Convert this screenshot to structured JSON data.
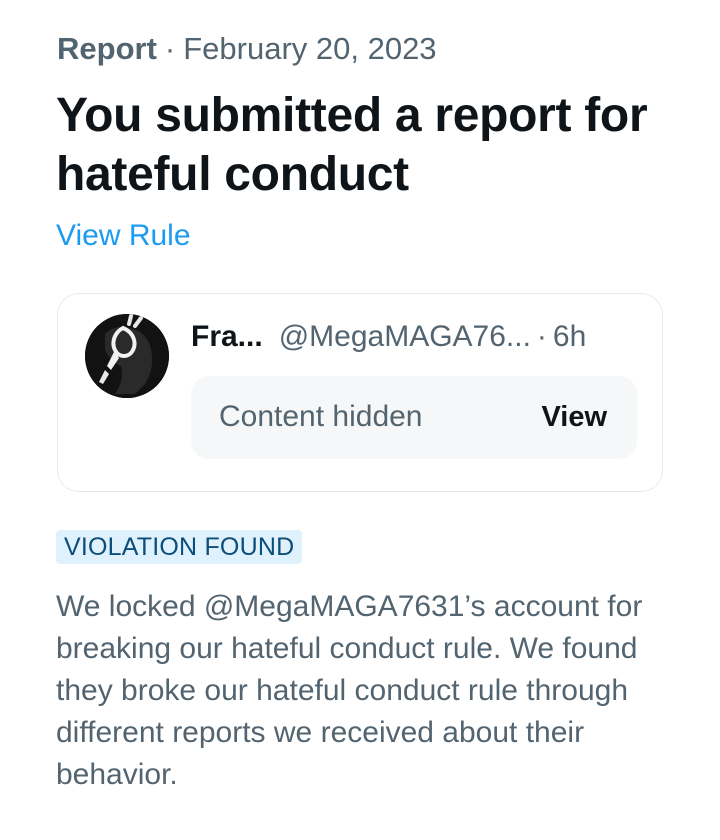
{
  "report": {
    "label": "Report",
    "separator": "·",
    "date": "February 20, 2023",
    "title": "You submitted a report for hateful conduct",
    "view_rule": "View Rule"
  },
  "card": {
    "display_name": "Fra...",
    "handle": "@MegaMAGA76...",
    "separator": "·",
    "time": "6h",
    "content_hidden": "Content hidden",
    "view_label": "View"
  },
  "result": {
    "badge": "VIOLATION FOUND",
    "description": "We locked @MegaMAGA7631’s account for breaking our hateful conduct rule. We found they broke our hateful conduct rule through different reports we received about their behavior."
  },
  "colors": {
    "link": "#1d9bf0",
    "muted": "#536471",
    "badge_bg": "#def1fd",
    "badge_text": "#0d4d7a"
  }
}
